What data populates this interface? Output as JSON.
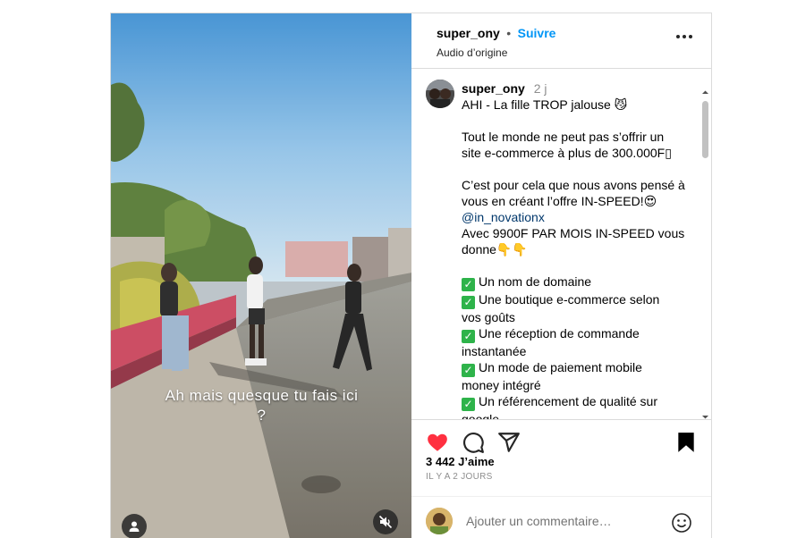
{
  "header": {
    "username": "super_ony",
    "dot": "•",
    "follow_label": "Suivre",
    "audio": "Audio d’origine"
  },
  "video": {
    "caption_line1": "Ah mais quesque tu fais ici",
    "caption_line2": "?"
  },
  "caption": {
    "username": "super_ony",
    "time": "2 j",
    "line1": "AHI - La fille TROP jalouse 😼",
    "line2": "Tout le monde ne peut pas s’offrir un",
    "line3": "site e-commerce à plus de 300.000F▯",
    "line4": "C’est pour cela que nous avons pensé à",
    "line5": "vous en créant l’offre IN-SPEED!😍",
    "mention": "@in_novationx",
    "line6": "Avec 9900F PAR MOIS IN-SPEED vous",
    "line7": "donne👇👇",
    "features": [
      "Un nom de domaine",
      "Une boutique e-commerce selon",
      "vos goûts",
      "Une réception de commande",
      "instantanée",
      "Un mode de paiement mobile",
      "money intégré",
      "Un référencement de qualité sur",
      "google"
    ]
  },
  "stats": {
    "likes": "3 442 J’aime",
    "date": "IL Y A 2 JOURS"
  },
  "comment_box": {
    "placeholder": "Ajouter un commentaire…"
  },
  "colors": {
    "follow": "#0095f6",
    "like_red": "#ff3040",
    "check_green": "#2eb34a",
    "mention": "#00376b"
  },
  "icons": [
    "more-icon",
    "heart-icon",
    "comment-icon",
    "share-icon",
    "bookmark-icon",
    "emoji-icon",
    "mute-icon",
    "user-tag-icon"
  ]
}
